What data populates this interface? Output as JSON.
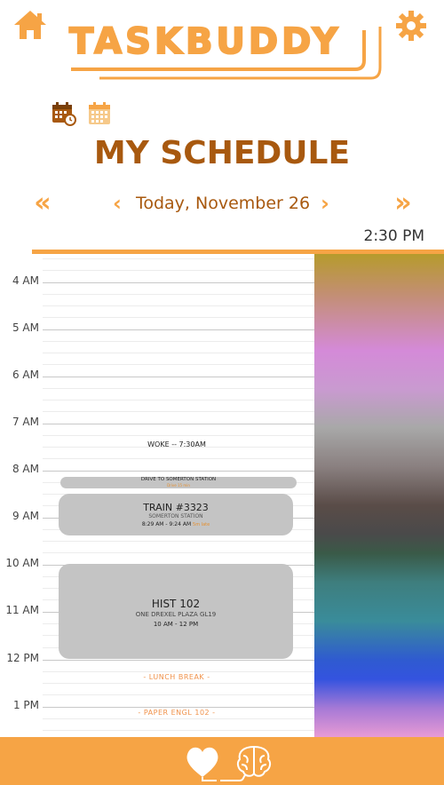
{
  "app": {
    "name": "TASKBUDDY"
  },
  "page": {
    "title": "MY SCHEDULE"
  },
  "navigation": {
    "date_label": "Today, November 26",
    "prev_week": "«",
    "prev_day": "‹",
    "next_day": "›",
    "next_week": "»"
  },
  "current_time": "2:30 PM",
  "view_icons": [
    "calendar-day-icon",
    "calendar-month-icon"
  ],
  "hours": [
    "4 AM",
    "5 AM",
    "6 AM",
    "7 AM",
    "8 AM",
    "9 AM",
    "10 AM",
    "11 AM",
    "12 PM",
    "1 PM"
  ],
  "markers": [
    {
      "label": "WOKE -- 7:30AM",
      "time": "7:30 AM"
    }
  ],
  "events": [
    {
      "title": "DRIVE TO SOMERTON STATION",
      "subtitle": "Drive 15 min",
      "start": "8:15 AM",
      "end": "8:29 AM"
    },
    {
      "title": "TRAIN #3323",
      "subtitle": "SOMERTON STATION",
      "time": "8:29 AM - 9:24 AM",
      "note": "5m late",
      "start": "8:29 AM",
      "end": "9:24 AM"
    },
    {
      "title": "HIST 102",
      "subtitle": "ONE DREXEL PLAZA GL19",
      "time": "10 AM - 12  PM",
      "start": "10 AM",
      "end": "12 PM"
    }
  ],
  "plain_tasks": [
    {
      "label": "- LUNCH BREAK -"
    },
    {
      "label": "- PAPER ENGL 102 -"
    }
  ],
  "colors": {
    "accent": "#f6a445",
    "title_brown": "#a8590f",
    "event_gray": "#c4c4c4",
    "footer": "#f6a445"
  },
  "footer_icons": [
    "heart-icon",
    "brain-icon"
  ]
}
